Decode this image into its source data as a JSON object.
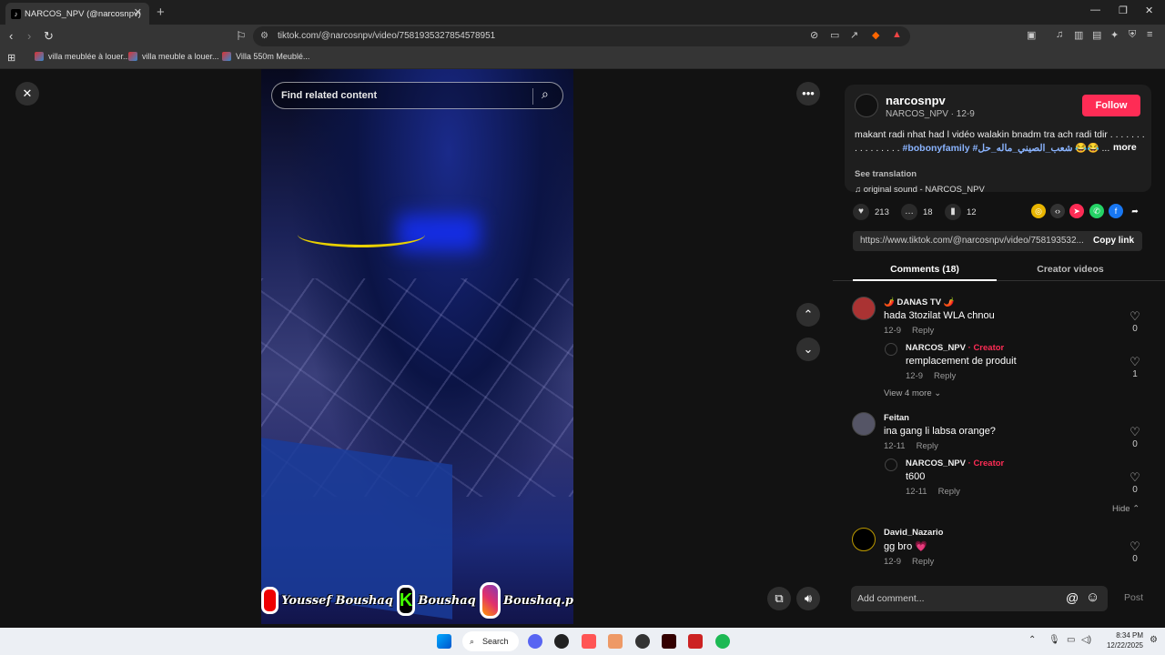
{
  "browser": {
    "tab_title": "NARCOS_NPV (@narcosnpv)",
    "tab_favicon": "tiktok-icon",
    "url": "tiktok.com/@narcosnpv/video/7581935327854578951",
    "bookmarks": [
      "villa meublée à louer...",
      "villa meuble a louer...",
      "Villa 550m Meublé..."
    ]
  },
  "video": {
    "search_placeholder": "Find related content",
    "banner_text_1": "Youssef Boushaq",
    "banner_text_2": "Boushaq",
    "banner_text_3": "Boushaq.p",
    "banner_k": "K"
  },
  "post": {
    "username": "narcosnpv",
    "subline": "NARCOS_NPV · 12-9",
    "follow_label": "Follow",
    "description": "makant radi nhat had l vidéo walakin bnadm tra ach radi tdir . . . . . . . . . . . . . . . . ",
    "hashtag1": "#bobonyfamily",
    "hashtag2": "#شعب_الصيني_ماله_حل",
    "emojis": "😂😂 ...",
    "more_label": "more",
    "see_translation": "See translation",
    "sound": "original sound - NARCOS_NPV",
    "likes": "213",
    "comments": "18",
    "saves": "12",
    "link": "https://www.tiktok.com/@narcosnpv/video/758193532...",
    "copy_link": "Copy link"
  },
  "tabs": {
    "comments": "Comments (18)",
    "creator": "Creator videos"
  },
  "comments": [
    {
      "name": "🌶️ DANAS TV 🌶️",
      "text": "hada 3tozilat WLA chnou",
      "date": "12-9",
      "reply": "Reply",
      "likes": "0"
    },
    {
      "name": "NARCOS_NPV",
      "badge": "· Creator",
      "text": "remplacement de produit",
      "date": "12-9",
      "reply": "Reply",
      "likes": "1"
    },
    {
      "name": "Feitan",
      "text": "ina gang li labsa orange?",
      "date": "12-11",
      "reply": "Reply",
      "likes": "0"
    },
    {
      "name": "NARCOS_NPV",
      "badge": "· Creator",
      "text": "t600",
      "date": "12-11",
      "reply": "Reply",
      "likes": "0"
    },
    {
      "name": "David_Nazario",
      "text": "gg bro 💗",
      "date": "12-9",
      "reply": "Reply",
      "likes": "0"
    }
  ],
  "view_more": "View 4 more",
  "hide": "Hide",
  "add_comment_placeholder": "Add comment...",
  "post_label": "Post",
  "taskbar": {
    "search": "Search",
    "time": "8:34 PM",
    "date": "12/22/2025"
  },
  "colors": {
    "accent": "#fe2c55",
    "hashtag": "#8ab4ff"
  }
}
